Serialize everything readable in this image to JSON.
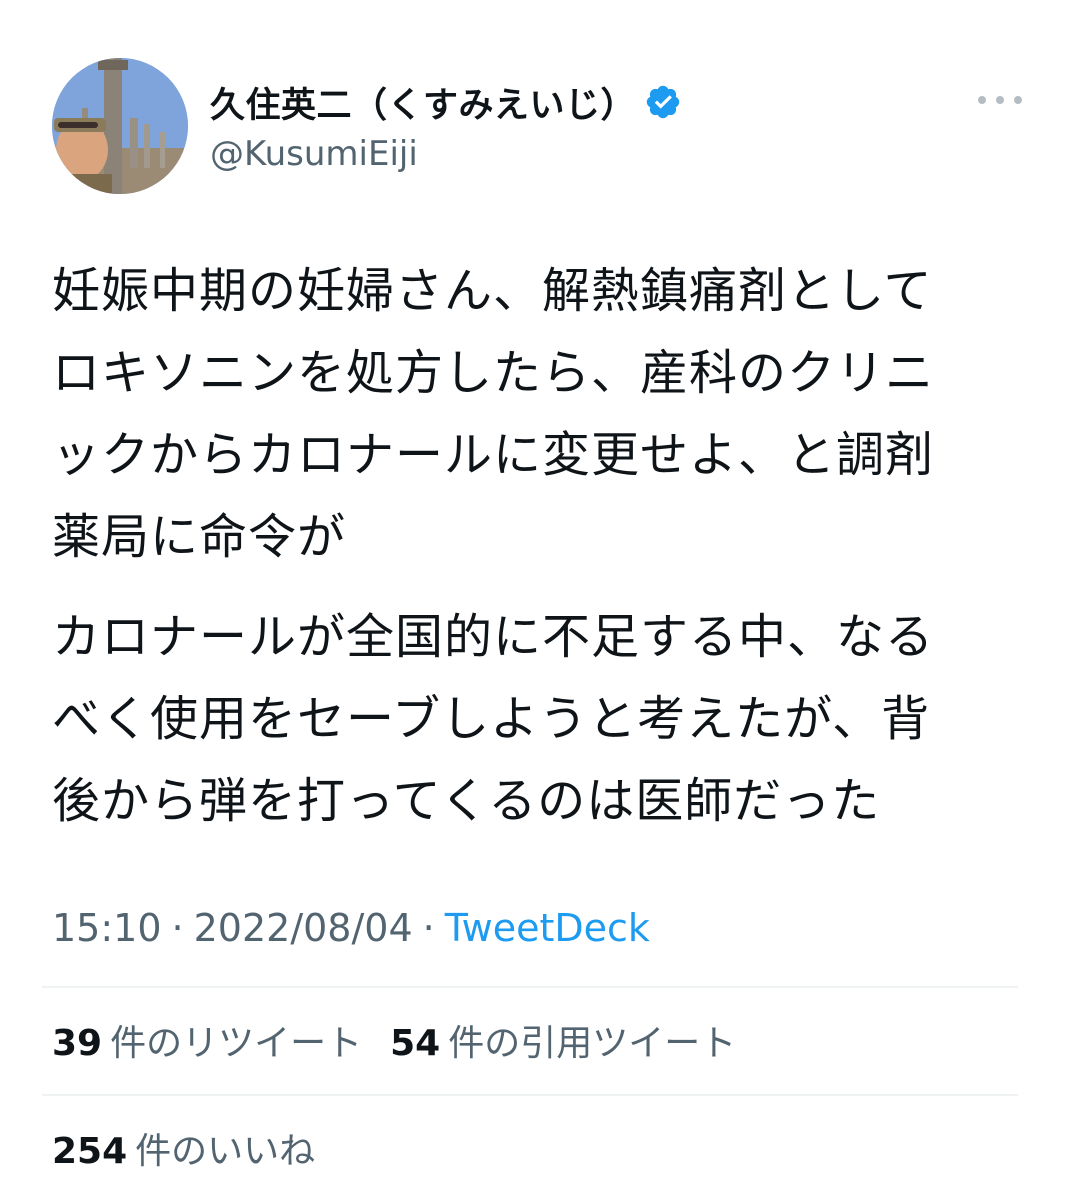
{
  "author": {
    "display_name": "久住英二（くすみえいじ）",
    "handle": "@KusumiEiji",
    "verified": true,
    "avatar_icon": "profile-photo"
  },
  "menu": {
    "more_icon": "more-horizontal-icon"
  },
  "tweet": {
    "paragraphs": [
      "妊娠中期の妊婦さん、解熱鎮痛剤として\nロキソニンを処方したら、産科のクリニ\nックからカロナールに変更せよ、と調剤\n薬局に命令が",
      "カロナールが全国的に不足する中、なる\nべく使用をセーブしようと考えたが、背\n後から弾を打ってくるのは医師だった"
    ]
  },
  "meta": {
    "time": "15:10",
    "separator": "·",
    "date": "2022/08/04",
    "source": "TweetDeck"
  },
  "stats": {
    "retweets": {
      "count": "39",
      "label": "件のリツイート"
    },
    "quotes": {
      "count": "54",
      "label": "件の引用ツイート"
    },
    "likes": {
      "count": "254",
      "label": "件のいいね"
    }
  },
  "colors": {
    "text": "#0f1419",
    "secondary": "#536471",
    "link": "#1d9bf0",
    "verified_badge": "#1d9bf0",
    "divider": "#eff3f4"
  }
}
